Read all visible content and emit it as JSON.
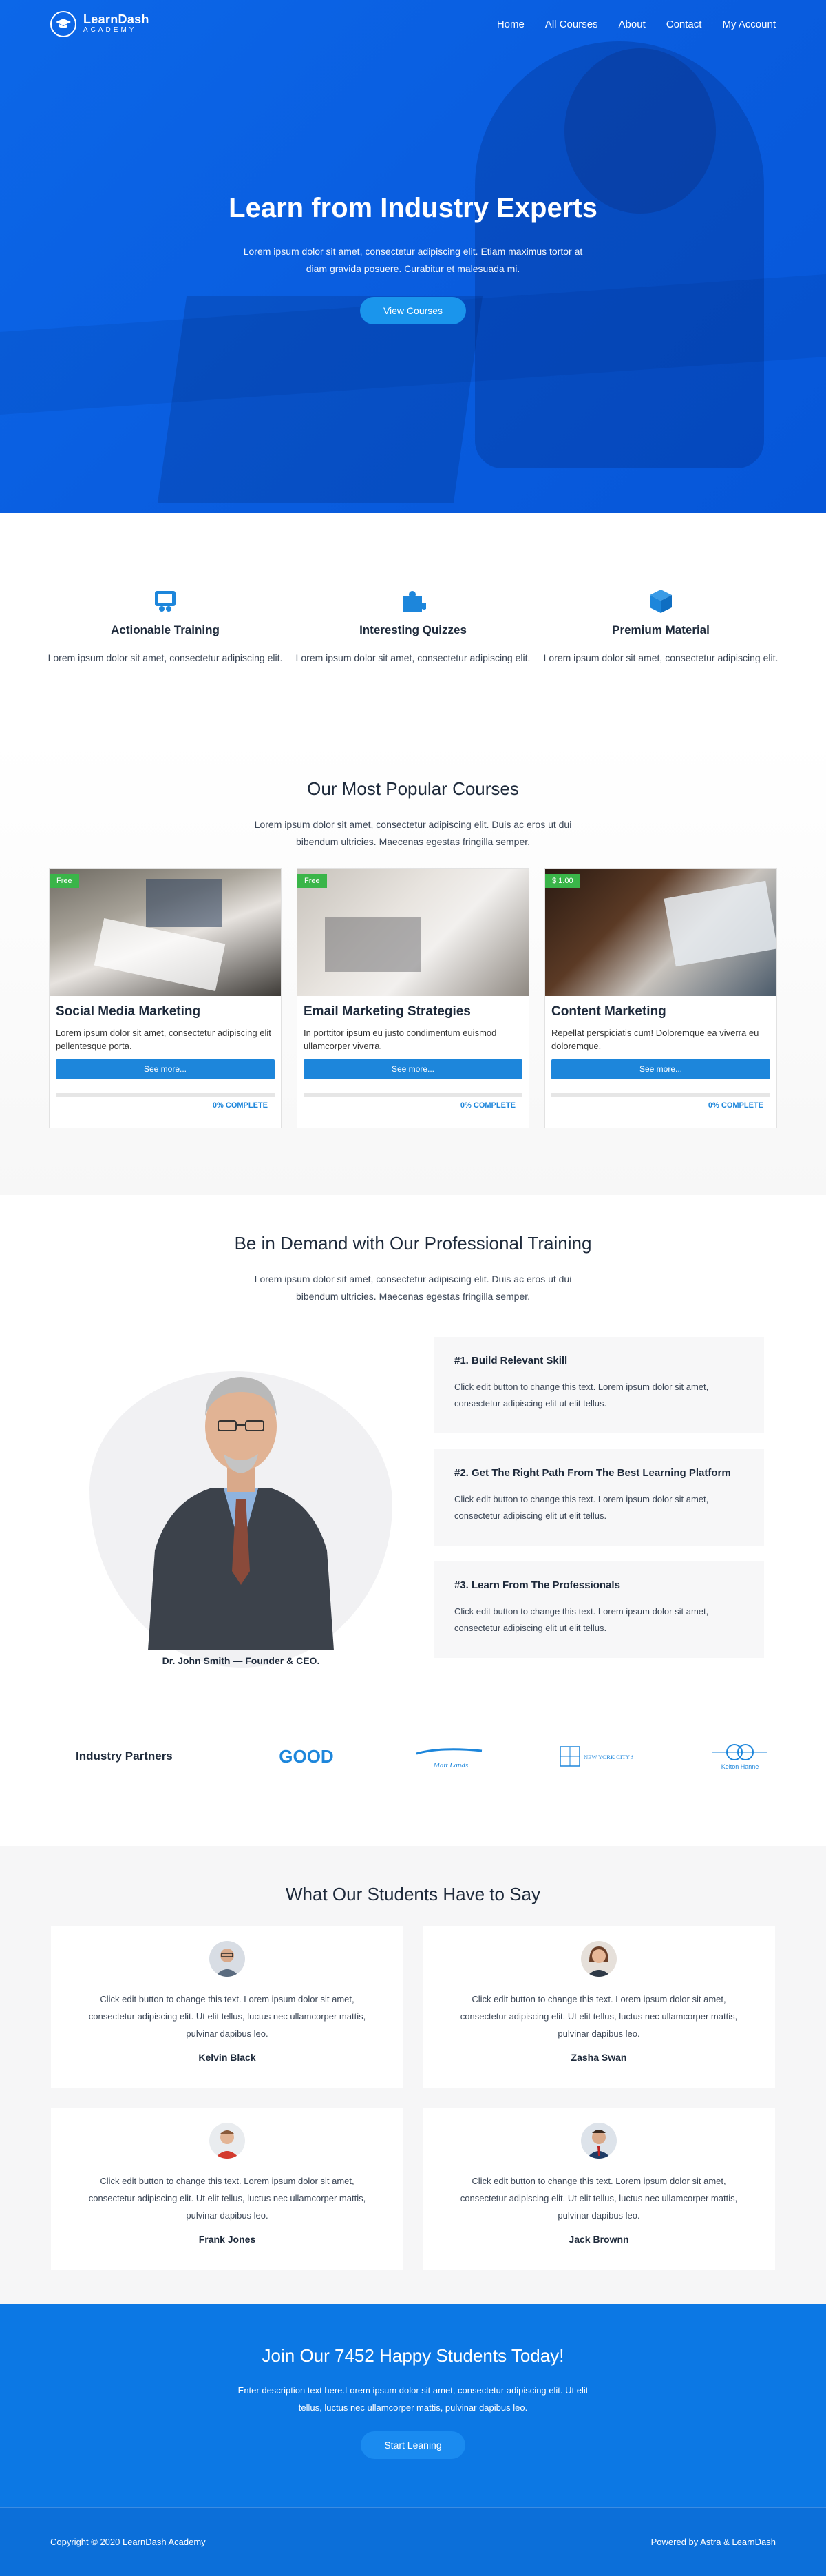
{
  "nav": {
    "brand_name": "LearnDash",
    "brand_sub": "ACADEMY",
    "brand_icon": "graduation-cap-icon",
    "items": [
      "Home",
      "All Courses",
      "About",
      "Contact",
      "My Account"
    ]
  },
  "hero": {
    "title": "Learn from Industry Experts",
    "text": "Lorem ipsum dolor sit amet, consectetur adipiscing elit. Etiam maximus tortor at diam gravida posuere. Curabitur et malesuada mi.",
    "button": "View Courses"
  },
  "features": [
    {
      "icon": "training-board-icon",
      "title": "Actionable Training",
      "text": "Lorem ipsum dolor sit amet, consectetur adipiscing elit."
    },
    {
      "icon": "puzzle-icon",
      "title": "Interesting Quizzes",
      "text": "Lorem ipsum dolor sit amet, consectetur adipiscing elit."
    },
    {
      "icon": "cube-icon",
      "title": "Premium Material",
      "text": "Lorem ipsum dolor sit amet, consectetur adipiscing elit."
    }
  ],
  "courses": {
    "title": "Our Most Popular Courses",
    "subtitle": "Lorem ipsum dolor sit amet, consectetur adipiscing elit. Duis ac eros ut dui bibendum ultricies. Maecenas egestas fringilla semper.",
    "items": [
      {
        "ribbon": "Free",
        "title": "Social Media Marketing",
        "text": "Lorem ipsum dolor sit amet, consectetur adipiscing elit pellentesque porta.",
        "button": "See more...",
        "progress": 0,
        "progress_label": "0% COMPLETE"
      },
      {
        "ribbon": "Free",
        "title": "Email Marketing Strategies",
        "text": "In porttitor ipsum eu justo condimentum euismod ullamcorper viverra.",
        "button": "See more...",
        "progress": 0,
        "progress_label": "0% COMPLETE"
      },
      {
        "ribbon": "$ 1.00",
        "title": "Content Marketing",
        "text": "Repellat perspiciatis cum! Doloremque ea viverra eu doloremque.",
        "button": "See more...",
        "progress": 0,
        "progress_label": "0% COMPLETE"
      }
    ]
  },
  "training": {
    "title": "Be in Demand with Our Professional Training",
    "subtitle": "Lorem ipsum dolor sit amet, consectetur adipiscing elit. Duis ac eros ut dui bibendum ultricies. Maecenas egestas fringilla semper.",
    "ceo_caption": "Dr. John Smith — Founder & CEO.",
    "steps": [
      {
        "title": "#1. Build Relevant Skill",
        "text": "Click edit button to change this text. Lorem ipsum dolor sit amet, consectetur adipiscing elit ut elit tellus."
      },
      {
        "title": "#2. Get The Right Path From The Best Learning Platform",
        "text": "Click edit button to change this text. Lorem ipsum dolor sit amet, consectetur adipiscing elit ut elit tellus."
      },
      {
        "title": "#3. Learn From The Professionals",
        "text": "Click edit button to change this text. Lorem ipsum dolor sit amet, consectetur adipiscing elit ut elit tellus."
      }
    ]
  },
  "partners": {
    "label": "Industry Partners",
    "logos": [
      "GOOD",
      "Matt Lands",
      "NEW YORK CITY STYLE",
      "Kelton Hanne"
    ]
  },
  "testimonials": {
    "title": "What Our Students Have to Say",
    "items": [
      {
        "text": "Click edit button to change this text. Lorem ipsum dolor sit amet, consectetur adipiscing elit. Ut elit tellus, luctus nec ullamcorper mattis, pulvinar dapibus leo.",
        "name": "Kelvin Black"
      },
      {
        "text": "Click edit button to change this text. Lorem ipsum dolor sit amet, consectetur adipiscing elit. Ut elit tellus, luctus nec ullamcorper mattis, pulvinar dapibus leo.",
        "name": "Zasha Swan"
      },
      {
        "text": "Click edit button to change this text. Lorem ipsum dolor sit amet, consectetur adipiscing elit. Ut elit tellus, luctus nec ullamcorper mattis, pulvinar dapibus leo.",
        "name": "Frank Jones"
      },
      {
        "text": "Click edit button to change this text. Lorem ipsum dolor sit amet, consectetur adipiscing elit. Ut elit tellus, luctus nec ullamcorper mattis, pulvinar dapibus leo.",
        "name": "Jack Brownn"
      }
    ]
  },
  "cta": {
    "title": "Join Our 7452 Happy Students Today!",
    "text": "Enter description text here.Lorem ipsum dolor sit amet, consectetur adipiscing elit. Ut elit tellus, luctus nec ullamcorper mattis, pulvinar dapibus leo.",
    "button": "Start Leaning"
  },
  "footer": {
    "copyright": "Copyright © 2020 LearnDash Academy",
    "powered": "Powered by Astra & LearnDash"
  },
  "colors": {
    "primary": "#0c6fd9",
    "button_blue": "#1d86db",
    "ribbon_green": "#3ab549",
    "text_dark": "#1e2a3b"
  }
}
